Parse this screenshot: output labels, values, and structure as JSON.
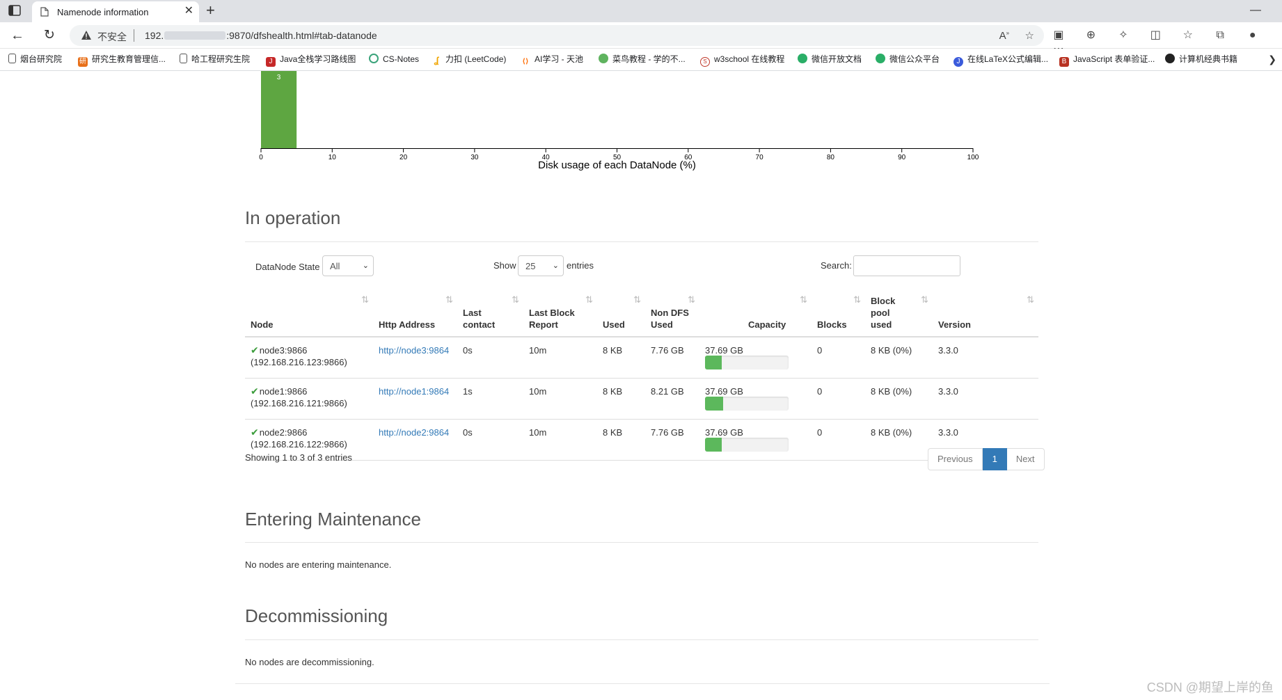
{
  "browser": {
    "tab_title": "Namenode information",
    "address_insecure": "不安全",
    "url_prefix": "192.",
    "url_suffix": ":9870/dfshealth.html#tab-datanode",
    "bookmarks": [
      {
        "label": "烟台研究院",
        "icon": "page-icon"
      },
      {
        "label": "研究生教育管理信...",
        "icon": "orange-icon"
      },
      {
        "label": "哈工程研究生院",
        "icon": "page-icon"
      },
      {
        "label": "Java全栈学习路线图",
        "icon": "java-icon"
      },
      {
        "label": "CS-Notes",
        "icon": "green-circle-icon"
      },
      {
        "label": "力扣 (LeetCode)",
        "icon": "leetcode-icon"
      },
      {
        "label": "AI学习 - 天池",
        "icon": "tianchi-icon"
      },
      {
        "label": "菜鸟教程 - 学的不...",
        "icon": "runoob-icon"
      },
      {
        "label": "w3school 在线教程",
        "icon": "w3school-icon"
      },
      {
        "label": "微信开放文档",
        "icon": "wechat-icon"
      },
      {
        "label": "微信公众平台",
        "icon": "wechat-icon"
      },
      {
        "label": "在线LaTeX公式编辑...",
        "icon": "latex-icon"
      },
      {
        "label": "JavaScript 表单验证...",
        "icon": "js-icon"
      },
      {
        "label": "计算机经典书籍",
        "icon": "github-icon"
      }
    ]
  },
  "chart_data": {
    "type": "bar",
    "xlabel": "Disk usage of each DataNode (%)",
    "xlim": [
      0,
      100
    ],
    "xticks": [
      "0",
      "10",
      "20",
      "30",
      "40",
      "50",
      "60",
      "70",
      "80",
      "90",
      "100"
    ],
    "bins": [
      {
        "range": [
          0,
          5
        ],
        "count": 3
      }
    ],
    "bar_label": "3",
    "bar_color": "#5ea641"
  },
  "in_operation": {
    "title": "In operation",
    "state_label": "DataNode State",
    "state_value": "All",
    "show_label": "Show",
    "show_value": "25",
    "entries_label": "entries",
    "search_label": "Search:",
    "columns": [
      "Node",
      "Http Address",
      "Last contact",
      "Last Block Report",
      "Used",
      "Non DFS Used",
      "Capacity",
      "Blocks",
      "Block pool used",
      "Version"
    ],
    "rows": [
      {
        "node": "node3:9866",
        "ip": "(192.168.216.123:9866)",
        "http": "http://node3:9864",
        "last_contact": "0s",
        "last_block_report": "10m",
        "used": "8 KB",
        "non_dfs": "7.76 GB",
        "capacity": "37.69 GB",
        "capacity_fill": 0.2,
        "blocks": "0",
        "block_pool": "8 KB (0%)",
        "version": "3.3.0"
      },
      {
        "node": "node1:9866",
        "ip": "(192.168.216.121:9866)",
        "http": "http://node1:9864",
        "last_contact": "1s",
        "last_block_report": "10m",
        "used": "8 KB",
        "non_dfs": "8.21 GB",
        "capacity": "37.69 GB",
        "capacity_fill": 0.22,
        "blocks": "0",
        "block_pool": "8 KB (0%)",
        "version": "3.3.0"
      },
      {
        "node": "node2:9866",
        "ip": "(192.168.216.122:9866)",
        "http": "http://node2:9864",
        "last_contact": "0s",
        "last_block_report": "10m",
        "used": "8 KB",
        "non_dfs": "7.76 GB",
        "capacity": "37.69 GB",
        "capacity_fill": 0.2,
        "blocks": "0",
        "block_pool": "8 KB (0%)",
        "version": "3.3.0"
      }
    ],
    "showing": "Showing 1 to 3 of 3 entries",
    "pager": {
      "previous": "Previous",
      "current": "1",
      "next": "Next"
    }
  },
  "entering_maintenance": {
    "title": "Entering Maintenance",
    "note": "No nodes are entering maintenance."
  },
  "decommissioning": {
    "title": "Decommissioning",
    "note": "No nodes are decommissioning."
  },
  "watermark": "CSDN @期望上岸的鱼"
}
